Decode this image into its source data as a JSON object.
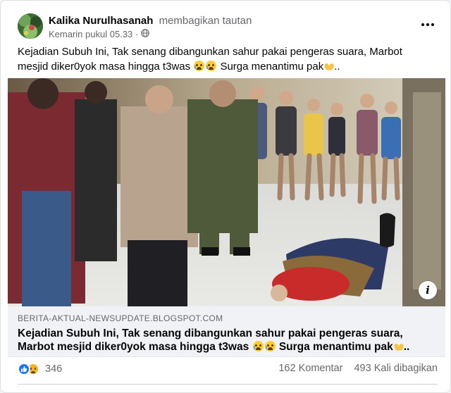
{
  "post": {
    "author": "Kalika Nurulhasanah",
    "action": "membagikan tautan",
    "timestamp": "Kemarin pukul 05.33 · ",
    "privacy_icon": "globe-icon",
    "more_icon": "more-options-icon",
    "text_part1": "Kejadian Subuh Ini, Tak senang dibangunkan sahur pakai pengeras suara, Marbot mesjid diker0yok masa hingga t3was ",
    "text_part2": " Surga menantimu pak",
    "text_part3": ".."
  },
  "link_preview": {
    "domain": "BERITA-AKTUAL-NEWSUPDATE.BLOGSPOT.COM",
    "title_part1": "Kejadian Subuh Ini, Tak senang dibangunkan sahur pakai pengeras suara, Marbot mesjid diker0yok masa hingga t3was ",
    "title_part2": " Surga menantimu pak",
    "title_part3": "..",
    "info_icon": "info-icon"
  },
  "stats": {
    "reaction_icons": [
      "like-icon",
      "sad-icon"
    ],
    "reaction_count": "346",
    "comments": "162 Komentar",
    "shares": "493 Kali dibagikan"
  },
  "colors": {
    "like_blue": "#1877f2",
    "secondary_text": "#65676b",
    "link_box_bg": "#f0f2f5"
  }
}
